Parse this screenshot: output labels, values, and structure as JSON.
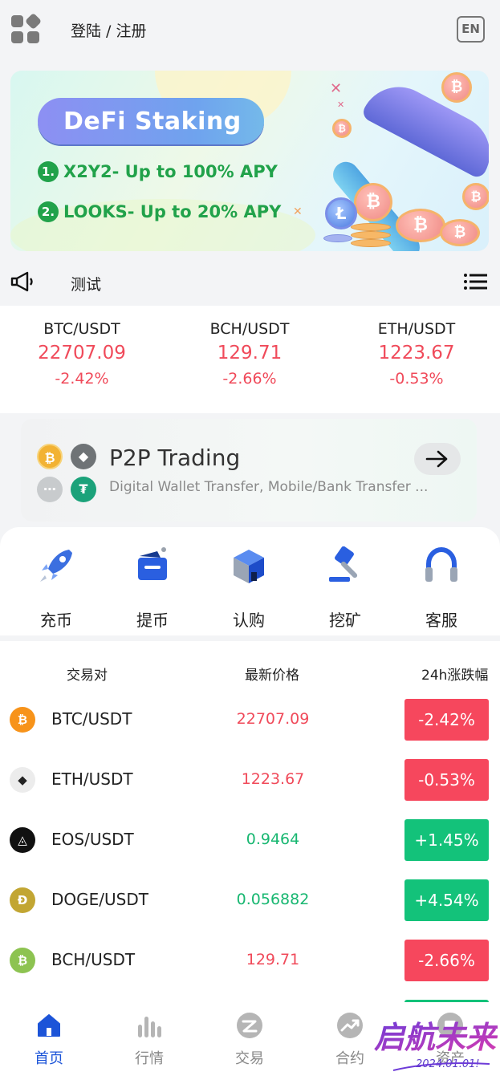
{
  "header": {
    "login_label": "登陆 / 注册",
    "lang_label": "EN"
  },
  "banner": {
    "title": "DeFi Staking",
    "items": [
      {
        "num": "1.",
        "text": "X2Y2- Up to 100% APY"
      },
      {
        "num": "2.",
        "text": "LOOKS- Up to 20% APY"
      }
    ]
  },
  "notice": {
    "text": "测试"
  },
  "tickers": [
    {
      "symbol": "BTC/USDT",
      "price": "22707.09",
      "change": "-2.42%"
    },
    {
      "symbol": "BCH/USDT",
      "price": "129.71",
      "change": "-2.66%"
    },
    {
      "symbol": "ETH/USDT",
      "price": "1223.67",
      "change": "-0.53%"
    }
  ],
  "p2p": {
    "title": "P2P Trading",
    "subtitle": "Digital Wallet Transfer, Mobile/Bank Transfer ..."
  },
  "actions": [
    {
      "label": "充币",
      "icon": "rocket-icon"
    },
    {
      "label": "提币",
      "icon": "wallet-icon"
    },
    {
      "label": "认购",
      "icon": "cube-icon"
    },
    {
      "label": "挖矿",
      "icon": "hammer-icon"
    },
    {
      "label": "客服",
      "icon": "headset-icon"
    }
  ],
  "market": {
    "headers": {
      "pair": "交易对",
      "price": "最新价格",
      "change": "24h涨跌幅"
    },
    "rows": [
      {
        "pair": "BTC/USDT",
        "price": "22707.09",
        "change": "-2.42%",
        "direction": "down",
        "coin_color": "#f7931a",
        "coin_glyph": "₿"
      },
      {
        "pair": "ETH/USDT",
        "price": "1223.67",
        "change": "-0.53%",
        "direction": "down",
        "coin_color": "#ececec",
        "coin_glyph": "◆"
      },
      {
        "pair": "EOS/USDT",
        "price": "0.9464",
        "change": "+1.45%",
        "direction": "up",
        "coin_color": "#111111",
        "coin_glyph": "◬"
      },
      {
        "pair": "DOGE/USDT",
        "price": "0.056882",
        "change": "+4.54%",
        "direction": "up",
        "coin_color": "#c2a633",
        "coin_glyph": "Ð"
      },
      {
        "pair": "BCH/USDT",
        "price": "129.71",
        "change": "-2.66%",
        "direction": "down",
        "coin_color": "#8dc351",
        "coin_glyph": "₿"
      }
    ]
  },
  "tabbar": [
    {
      "label": "首页",
      "active": true
    },
    {
      "label": "行情",
      "active": false
    },
    {
      "label": "交易",
      "active": false
    },
    {
      "label": "合约",
      "active": false
    },
    {
      "label": "资产",
      "active": false
    }
  ],
  "watermark": {
    "text": "启航未来",
    "sub": "2024.01.01!"
  },
  "colors": {
    "up": "#13c27a",
    "down": "#f6475d",
    "accent": "#1c54d8"
  }
}
